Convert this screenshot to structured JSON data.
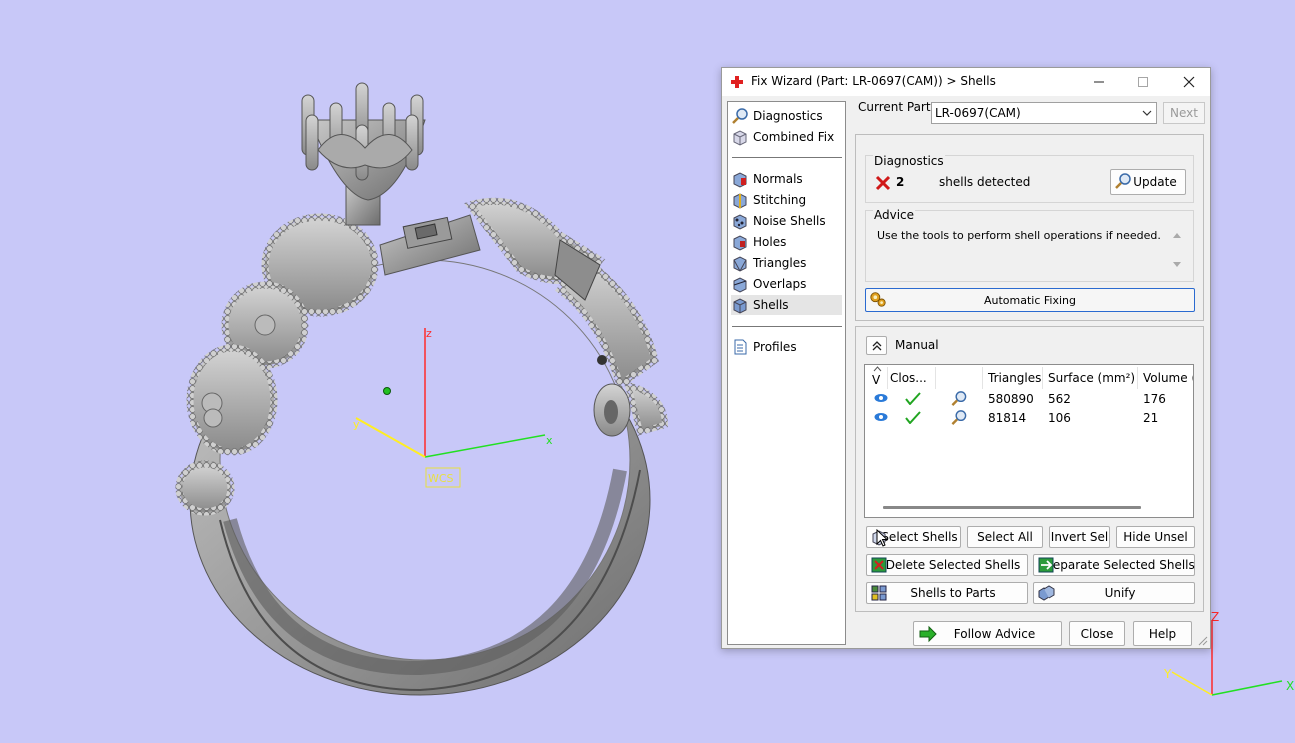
{
  "dialog": {
    "title": "Fix Wizard (Part: LR-0697(CAM)) > Shells",
    "minimize_glyph": "—",
    "maximize_glyph": "☐",
    "close_glyph": "✕"
  },
  "nav": {
    "items": [
      {
        "label": "Diagnostics",
        "icon": "magnifier-icon"
      },
      {
        "label": "Combined Fix",
        "icon": "cube-icon"
      },
      {
        "label": "Normals",
        "icon": "normals-cube-icon"
      },
      {
        "label": "Stitching",
        "icon": "stitching-cube-icon"
      },
      {
        "label": "Noise Shells",
        "icon": "noise-shells-icon"
      },
      {
        "label": "Holes",
        "icon": "holes-cube-icon"
      },
      {
        "label": "Triangles",
        "icon": "triangles-cube-icon"
      },
      {
        "label": "Overlaps",
        "icon": "overlaps-cube-icon"
      },
      {
        "label": "Shells",
        "icon": "shells-cube-icon",
        "selected": true
      },
      {
        "label": "Profiles",
        "icon": "document-icon"
      }
    ]
  },
  "header": {
    "current_part_label": "Current Part:",
    "current_part_value": "LR-0697(CAM)",
    "next_label": "Next"
  },
  "diagnostics": {
    "title": "Diagnostics",
    "count": "2",
    "status_text": "shells detected",
    "update_label": "Update"
  },
  "advice": {
    "title": "Advice",
    "text": "Use the tools to perform shell operations if needed."
  },
  "automatic_fixing_label": "Automatic Fixing",
  "manual": {
    "title": "Manual",
    "columns": [
      "V",
      "Clos...",
      "",
      "Triangles",
      "Surface (mm²)",
      "Volume ("
    ],
    "rows": [
      {
        "triangles": "580890",
        "surface": "562",
        "volume": "176"
      },
      {
        "triangles": "81814",
        "surface": "106",
        "volume": "21"
      }
    ],
    "buttons": {
      "select_shells": "Select Shells",
      "select_all": "Select All",
      "invert_sel": "Invert Sel",
      "hide_unsel": "Hide Unsel",
      "delete_selected": "Delete Selected Shells",
      "separate_selected": "Separate Selected Shells",
      "shells_to_parts": "Shells to Parts",
      "unify": "Unify"
    }
  },
  "footer": {
    "follow_advice": "Follow Advice",
    "close": "Close",
    "help": "Help"
  },
  "viewport": {
    "wcs_label": "WCS",
    "axis_x": "x",
    "axis_y": "y",
    "axis_z": "z",
    "corner_axis_x": "X",
    "corner_axis_y": "Y",
    "corner_axis_z": "Z",
    "background_color": "#c8c8f8"
  }
}
